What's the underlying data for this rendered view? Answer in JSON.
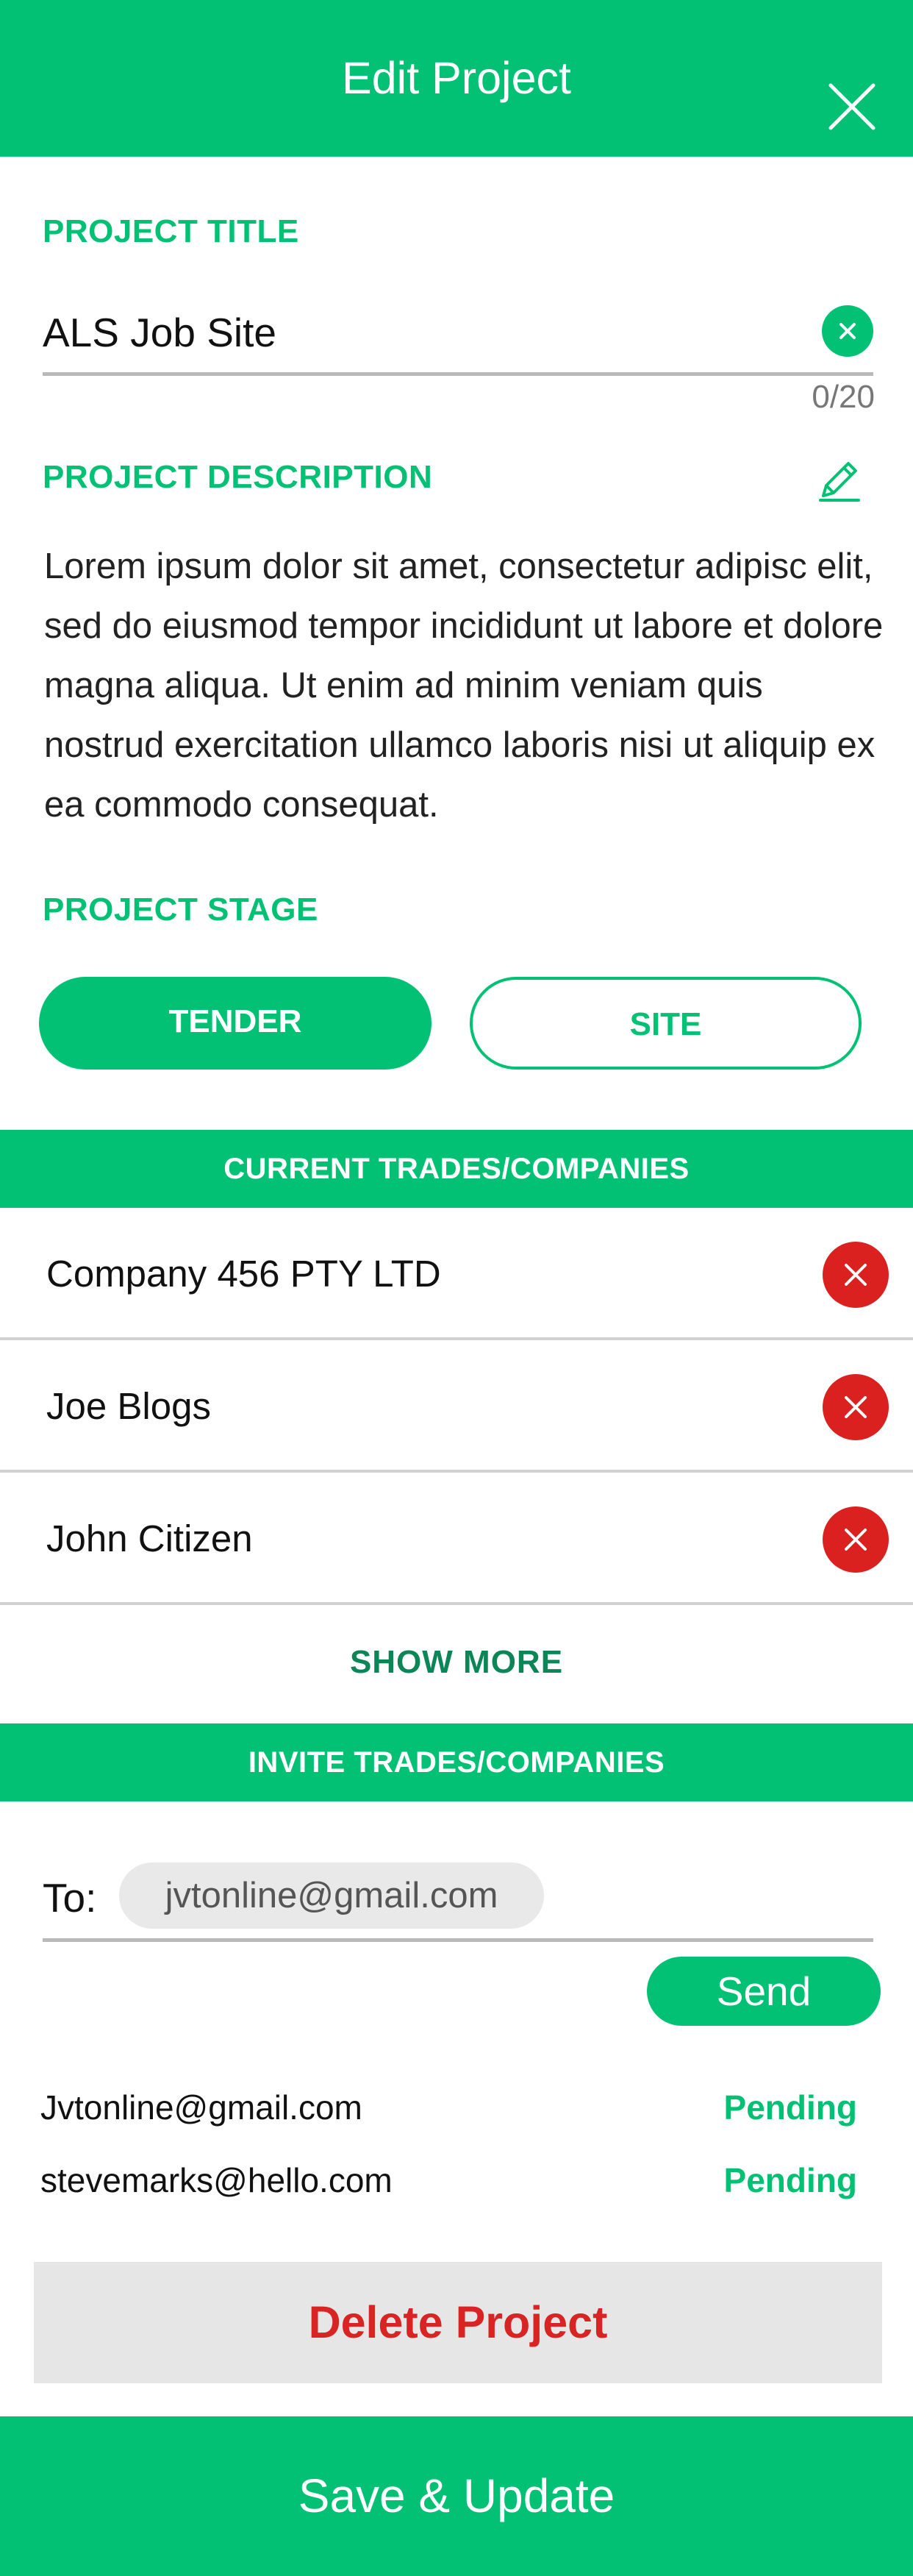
{
  "header": {
    "title": "Edit Project",
    "close_icon": "close-icon"
  },
  "project_title": {
    "label": "PROJECT TITLE",
    "value": "ALS Job Site",
    "counter": "0/20",
    "clear_icon": "clear-icon"
  },
  "project_description": {
    "label": "PROJECT DESCRIPTION",
    "edit_icon": "pencil-icon",
    "text": "Lorem ipsum dolor sit amet, consectetur adipisc elit, sed do eiusmod tempor incididunt ut labore et dolore magna aliqua. Ut enim ad minim veniam quis nostrud exercitation ullamco laboris nisi ut aliquip ex ea commodo consequat."
  },
  "project_stage": {
    "label": "PROJECT STAGE",
    "options": [
      "TENDER",
      "SITE"
    ],
    "selected": "TENDER"
  },
  "current_trades": {
    "title": "CURRENT TRADES/COMPANIES",
    "items": [
      {
        "name": "Company 456 PTY LTD"
      },
      {
        "name": "Joe Blogs"
      },
      {
        "name": "John Citizen"
      }
    ],
    "show_more_label": "SHOW MORE"
  },
  "invite": {
    "title": "INVITE TRADES/COMPANIES",
    "to_label": "To:",
    "email_chip": "jvtonline@gmail.com",
    "send_label": "Send",
    "invites": [
      {
        "email": "Jvtonline@gmail.com",
        "status": "Pending"
      },
      {
        "email": "stevemarks@hello.com",
        "status": "Pending"
      }
    ]
  },
  "delete_label": "Delete Project",
  "save_label": "Save & Update",
  "colors": {
    "primary": "#02c175",
    "danger": "#db2020",
    "muted_bg": "#e6e6e6"
  }
}
